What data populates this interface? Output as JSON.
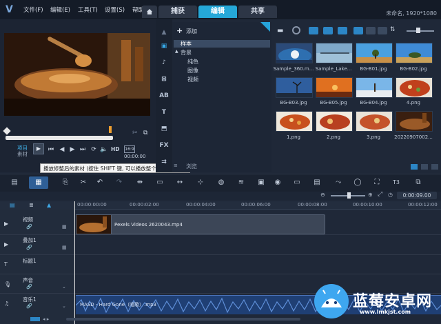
{
  "menu": [
    "文件(F)",
    "编辑(E)",
    "工具(T)",
    "设置(S)",
    "帮助"
  ],
  "tabs": [
    "捕获",
    "编辑",
    "共享"
  ],
  "resolution": "未命名, 1920*1080",
  "folder_panel": {
    "add_label": "添加",
    "tree": [
      "样本",
      "背景",
      "纯色",
      "图像",
      "视频"
    ],
    "browse_label": "浏览"
  },
  "library": {
    "thumbnails": [
      {
        "label": "Sample_360.m..."
      },
      {
        "label": "Sample_Lake..."
      },
      {
        "label": "BG-B01.jpg"
      },
      {
        "label": "BG-B02.jpg"
      },
      {
        "label": "BG-B03.jpg"
      },
      {
        "label": "BG-B05.jpg"
      },
      {
        "label": "BG-B04.jpg"
      },
      {
        "label": "4.png"
      },
      {
        "label": "1.png"
      },
      {
        "label": "2.png"
      },
      {
        "label": "3.png"
      },
      {
        "label": "20220907002..."
      }
    ]
  },
  "preview": {
    "mode_project": "项目",
    "mode_clip": "素材",
    "hd": "HD",
    "tooltip": "播放修整后的素材 (按住 SHIFT 键, 可以播放整个素材)",
    "timecode": "00:00:00"
  },
  "timeline": {
    "counter": "0:00:09.00",
    "ruler": [
      "00:00:00:00",
      "00:00:02:00",
      "00:00:04:00",
      "00:00:06:00",
      "00:00:08:00",
      "00:00:10:00",
      "00:00:12:00"
    ],
    "tracks": [
      "视频",
      "叠加1",
      "标题1",
      "声音",
      "音乐1"
    ],
    "video_clip_label": "Pexels Videos 2620043.mp4",
    "music_clip_label": "MASD - Hard Gone（唱歌）.mp3"
  },
  "watermark": {
    "title": "蓝莓安卓网",
    "url": "www.lmkjst.com"
  }
}
